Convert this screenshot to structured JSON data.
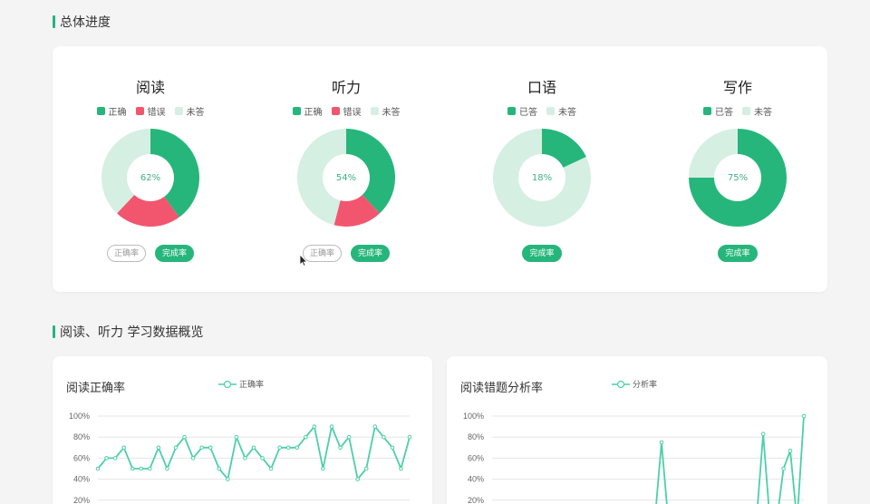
{
  "colors": {
    "accent": "#26b67b",
    "wrong": "#f2566e",
    "unanswered": "#d5efe3",
    "line": "#4ccfa9"
  },
  "section1": {
    "title": "总体进度"
  },
  "subjects": [
    {
      "title": "阅读",
      "legend": [
        {
          "label": "正确",
          "color": "#26b67b"
        },
        {
          "label": "错误",
          "color": "#f2566e"
        },
        {
          "label": "未答",
          "color": "#d5efe3"
        }
      ],
      "slices": [
        0.4,
        0.22,
        0.38
      ],
      "center_label": "62%",
      "buttons": [
        {
          "label": "正确率",
          "style": "outline"
        },
        {
          "label": "完成率",
          "style": "filled"
        }
      ]
    },
    {
      "title": "听力",
      "legend": [
        {
          "label": "正确",
          "color": "#26b67b"
        },
        {
          "label": "错误",
          "color": "#f2566e"
        },
        {
          "label": "未答",
          "color": "#d5efe3"
        }
      ],
      "slices": [
        0.38,
        0.16,
        0.46
      ],
      "center_label": "54%",
      "buttons": [
        {
          "label": "正确率",
          "style": "outline"
        },
        {
          "label": "完成率",
          "style": "filled"
        }
      ]
    },
    {
      "title": "口语",
      "legend": [
        {
          "label": "已答",
          "color": "#26b67b"
        },
        {
          "label": "未答",
          "color": "#d5efe3"
        }
      ],
      "slices": [
        0.18,
        0.82
      ],
      "center_label": "18%",
      "buttons": [
        {
          "label": "完成率",
          "style": "filled"
        }
      ]
    },
    {
      "title": "写作",
      "legend": [
        {
          "label": "已答",
          "color": "#26b67b"
        },
        {
          "label": "未答",
          "color": "#d5efe3"
        }
      ],
      "slices": [
        0.75,
        0.25
      ],
      "center_label": "75%",
      "buttons": [
        {
          "label": "完成率",
          "style": "filled"
        }
      ]
    }
  ],
  "section2": {
    "title": "阅读、听力 学习数据概览"
  },
  "chart_data": [
    {
      "type": "line",
      "title": "阅读正确率",
      "series": [
        {
          "name": "正确率",
          "values": [
            50,
            60,
            60,
            70,
            50,
            50,
            50,
            70,
            50,
            70,
            80,
            60,
            70,
            70,
            50,
            40,
            80,
            60,
            70,
            60,
            50,
            70,
            70,
            70,
            80,
            90,
            50,
            90,
            70,
            80,
            40,
            50,
            90,
            80,
            70,
            50,
            80
          ]
        }
      ],
      "y_ticks": [
        "100%",
        "80%",
        "60%",
        "40%",
        "20%"
      ],
      "ylim": [
        0,
        100
      ]
    },
    {
      "type": "line",
      "title": "阅读错题分析率",
      "series": [
        {
          "name": "分析率",
          "values": [
            0,
            0,
            0,
            0,
            0,
            0,
            0,
            0,
            0,
            0,
            0,
            0,
            0,
            0,
            0,
            0,
            0,
            0,
            0,
            0,
            0,
            0,
            0,
            0,
            0,
            75,
            0,
            0,
            0,
            0,
            0,
            0,
            0,
            0,
            0,
            0,
            0,
            0,
            0,
            0,
            83,
            0,
            0,
            50,
            67,
            0,
            100
          ]
        }
      ],
      "y_ticks": [
        "100%",
        "80%",
        "60%",
        "40%",
        "20%"
      ],
      "ylim": [
        0,
        100
      ]
    }
  ]
}
